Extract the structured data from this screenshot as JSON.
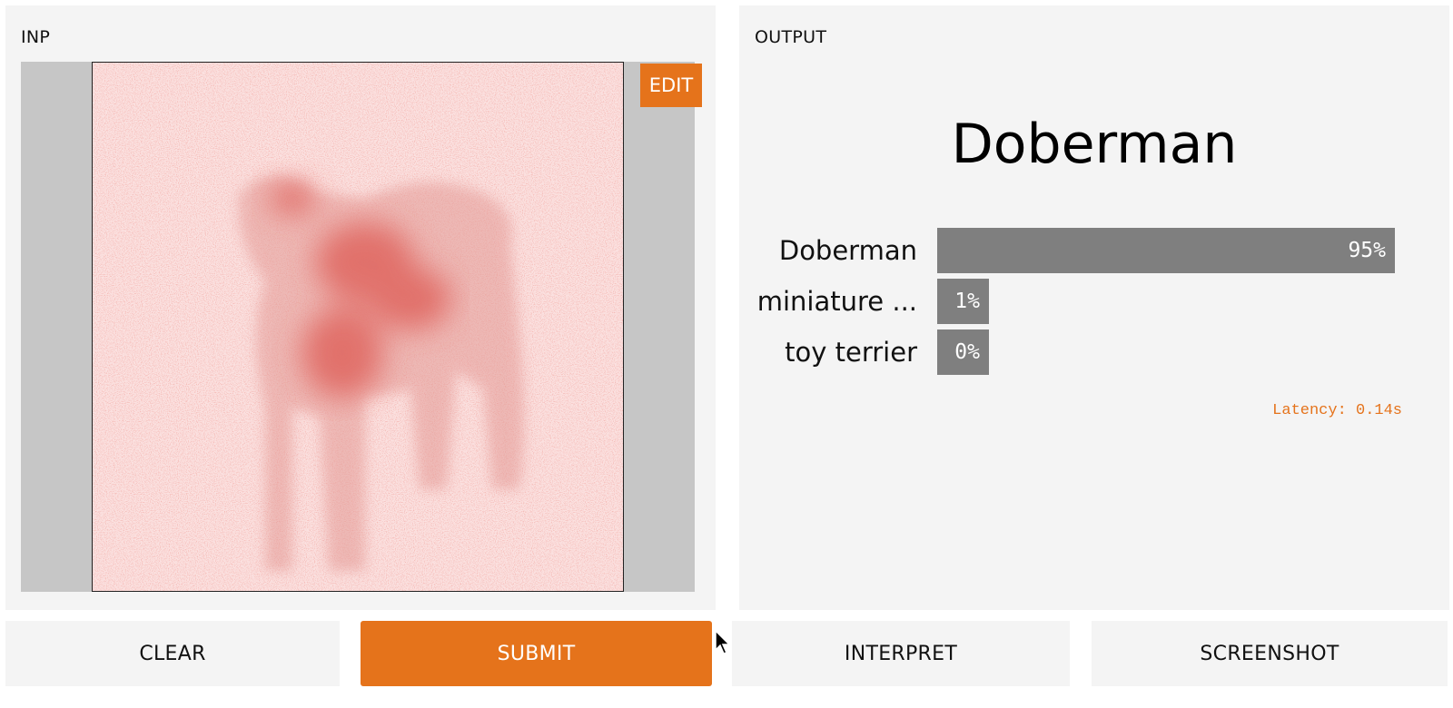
{
  "input": {
    "label": "INP",
    "edit_label": "EDIT"
  },
  "output": {
    "label": "OUTPUT",
    "predicted_label": "Doberman",
    "confidences": [
      {
        "label": "Doberman",
        "value_text": "95%",
        "value": 0.95
      },
      {
        "label": "miniature ...",
        "value_text": "1%",
        "value": 0.01
      },
      {
        "label": "toy terrier",
        "value_text": "0%",
        "value": 0.0
      }
    ],
    "latency": "Latency: 0.14s"
  },
  "buttons": {
    "clear": "CLEAR",
    "submit": "SUBMIT",
    "interpret": "INTERPRET",
    "screenshot": "SCREENSHOT"
  },
  "colors": {
    "accent": "#e5731b",
    "bar": "#7f7f7f",
    "panel_bg": "#f4f4f4",
    "heatmap": "#d9423a"
  },
  "icons": [
    "pointer-cursor-icon"
  ]
}
